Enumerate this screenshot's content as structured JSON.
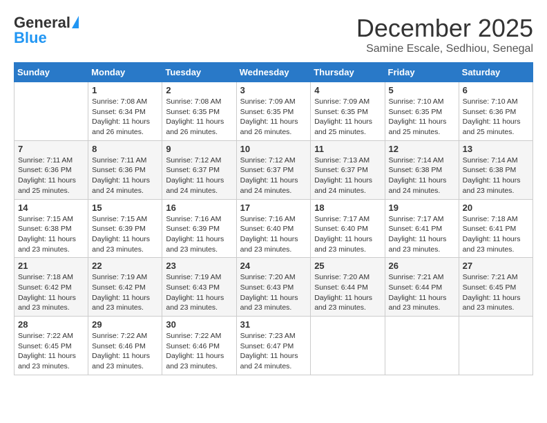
{
  "logo": {
    "general": "General",
    "blue": "Blue"
  },
  "title": "December 2025",
  "location": "Samine Escale, Sedhiou, Senegal",
  "days_of_week": [
    "Sunday",
    "Monday",
    "Tuesday",
    "Wednesday",
    "Thursday",
    "Friday",
    "Saturday"
  ],
  "weeks": [
    [
      {
        "day": null
      },
      {
        "day": 1,
        "sunrise": "7:08 AM",
        "sunset": "6:34 PM",
        "daylight": "11 hours and 26 minutes."
      },
      {
        "day": 2,
        "sunrise": "7:08 AM",
        "sunset": "6:35 PM",
        "daylight": "11 hours and 26 minutes."
      },
      {
        "day": 3,
        "sunrise": "7:09 AM",
        "sunset": "6:35 PM",
        "daylight": "11 hours and 26 minutes."
      },
      {
        "day": 4,
        "sunrise": "7:09 AM",
        "sunset": "6:35 PM",
        "daylight": "11 hours and 25 minutes."
      },
      {
        "day": 5,
        "sunrise": "7:10 AM",
        "sunset": "6:35 PM",
        "daylight": "11 hours and 25 minutes."
      },
      {
        "day": 6,
        "sunrise": "7:10 AM",
        "sunset": "6:36 PM",
        "daylight": "11 hours and 25 minutes."
      }
    ],
    [
      {
        "day": 7,
        "sunrise": "7:11 AM",
        "sunset": "6:36 PM",
        "daylight": "11 hours and 25 minutes."
      },
      {
        "day": 8,
        "sunrise": "7:11 AM",
        "sunset": "6:36 PM",
        "daylight": "11 hours and 24 minutes."
      },
      {
        "day": 9,
        "sunrise": "7:12 AM",
        "sunset": "6:37 PM",
        "daylight": "11 hours and 24 minutes."
      },
      {
        "day": 10,
        "sunrise": "7:12 AM",
        "sunset": "6:37 PM",
        "daylight": "11 hours and 24 minutes."
      },
      {
        "day": 11,
        "sunrise": "7:13 AM",
        "sunset": "6:37 PM",
        "daylight": "11 hours and 24 minutes."
      },
      {
        "day": 12,
        "sunrise": "7:14 AM",
        "sunset": "6:38 PM",
        "daylight": "11 hours and 24 minutes."
      },
      {
        "day": 13,
        "sunrise": "7:14 AM",
        "sunset": "6:38 PM",
        "daylight": "11 hours and 23 minutes."
      }
    ],
    [
      {
        "day": 14,
        "sunrise": "7:15 AM",
        "sunset": "6:38 PM",
        "daylight": "11 hours and 23 minutes."
      },
      {
        "day": 15,
        "sunrise": "7:15 AM",
        "sunset": "6:39 PM",
        "daylight": "11 hours and 23 minutes."
      },
      {
        "day": 16,
        "sunrise": "7:16 AM",
        "sunset": "6:39 PM",
        "daylight": "11 hours and 23 minutes."
      },
      {
        "day": 17,
        "sunrise": "7:16 AM",
        "sunset": "6:40 PM",
        "daylight": "11 hours and 23 minutes."
      },
      {
        "day": 18,
        "sunrise": "7:17 AM",
        "sunset": "6:40 PM",
        "daylight": "11 hours and 23 minutes."
      },
      {
        "day": 19,
        "sunrise": "7:17 AM",
        "sunset": "6:41 PM",
        "daylight": "11 hours and 23 minutes."
      },
      {
        "day": 20,
        "sunrise": "7:18 AM",
        "sunset": "6:41 PM",
        "daylight": "11 hours and 23 minutes."
      }
    ],
    [
      {
        "day": 21,
        "sunrise": "7:18 AM",
        "sunset": "6:42 PM",
        "daylight": "11 hours and 23 minutes."
      },
      {
        "day": 22,
        "sunrise": "7:19 AM",
        "sunset": "6:42 PM",
        "daylight": "11 hours and 23 minutes."
      },
      {
        "day": 23,
        "sunrise": "7:19 AM",
        "sunset": "6:43 PM",
        "daylight": "11 hours and 23 minutes."
      },
      {
        "day": 24,
        "sunrise": "7:20 AM",
        "sunset": "6:43 PM",
        "daylight": "11 hours and 23 minutes."
      },
      {
        "day": 25,
        "sunrise": "7:20 AM",
        "sunset": "6:44 PM",
        "daylight": "11 hours and 23 minutes."
      },
      {
        "day": 26,
        "sunrise": "7:21 AM",
        "sunset": "6:44 PM",
        "daylight": "11 hours and 23 minutes."
      },
      {
        "day": 27,
        "sunrise": "7:21 AM",
        "sunset": "6:45 PM",
        "daylight": "11 hours and 23 minutes."
      }
    ],
    [
      {
        "day": 28,
        "sunrise": "7:22 AM",
        "sunset": "6:45 PM",
        "daylight": "11 hours and 23 minutes."
      },
      {
        "day": 29,
        "sunrise": "7:22 AM",
        "sunset": "6:46 PM",
        "daylight": "11 hours and 23 minutes."
      },
      {
        "day": 30,
        "sunrise": "7:22 AM",
        "sunset": "6:46 PM",
        "daylight": "11 hours and 23 minutes."
      },
      {
        "day": 31,
        "sunrise": "7:23 AM",
        "sunset": "6:47 PM",
        "daylight": "11 hours and 24 minutes."
      },
      {
        "day": null
      },
      {
        "day": null
      },
      {
        "day": null
      }
    ]
  ],
  "labels": {
    "sunrise": "Sunrise:",
    "sunset": "Sunset:",
    "daylight": "Daylight:"
  }
}
